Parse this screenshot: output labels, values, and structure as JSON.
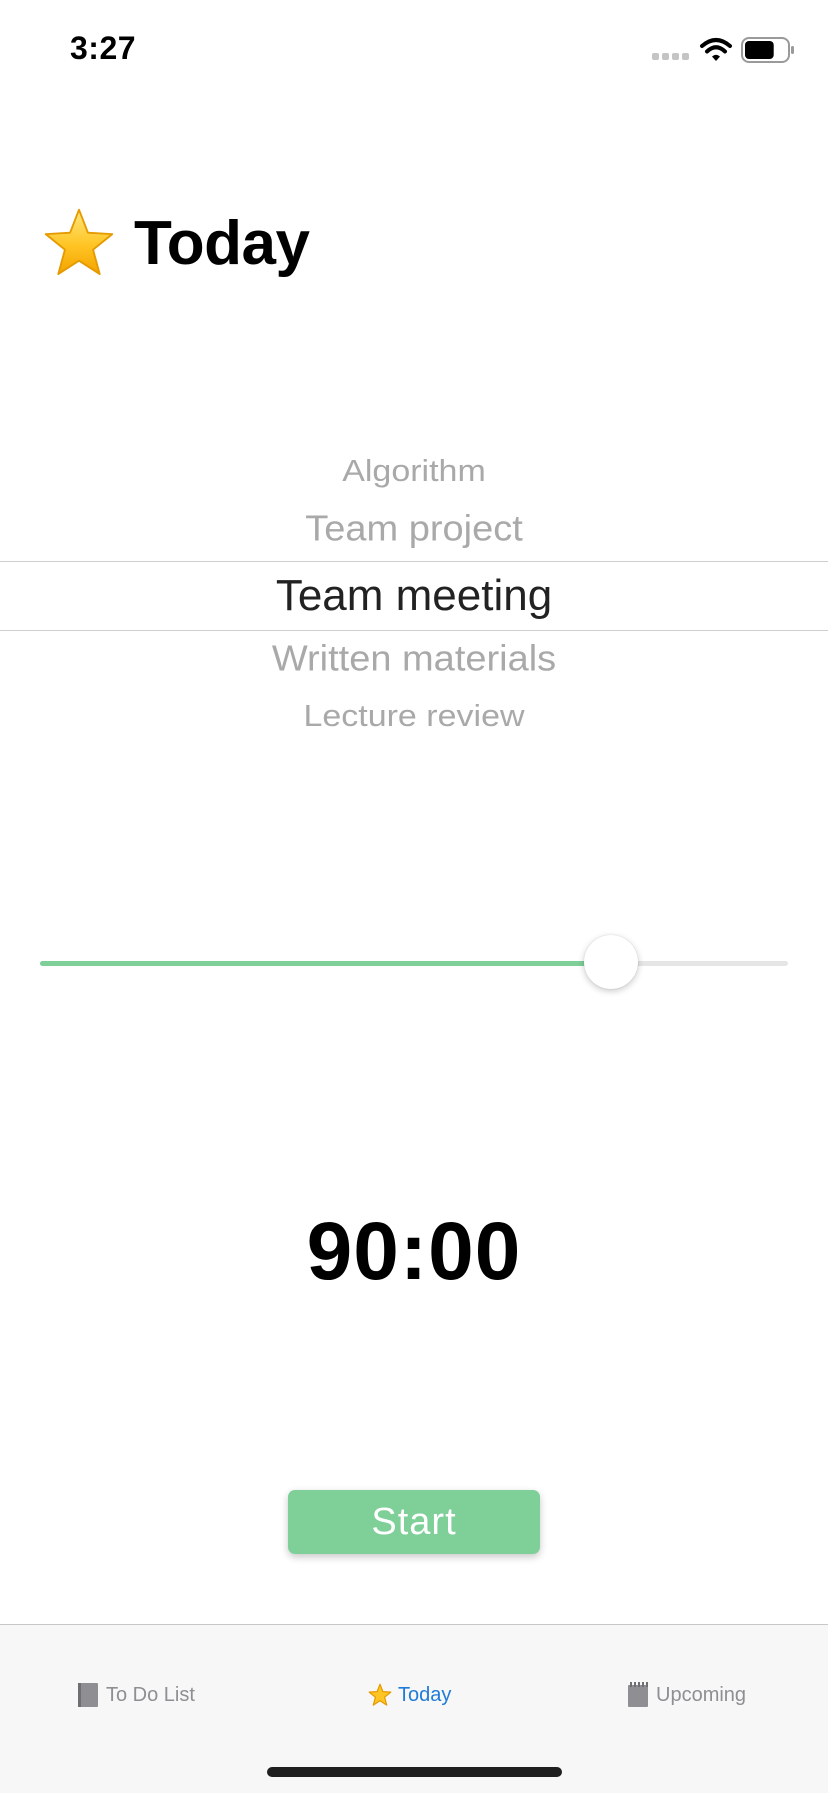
{
  "status_bar": {
    "time": "3:27",
    "icons": [
      "signal-icon",
      "wifi-icon",
      "battery-icon"
    ],
    "battery_level": 0.7
  },
  "header": {
    "icon": "star-icon",
    "title": "Today"
  },
  "picker": {
    "items": [
      "Algorithm",
      "Team project",
      "Team meeting",
      "Written materials",
      "Lecture review"
    ],
    "selected": "Team meeting"
  },
  "slider": {
    "value": 0.764,
    "fill_color": "#7ecf98",
    "track_color": "#e5e5e5"
  },
  "timer": {
    "display": "90:00"
  },
  "start_button": {
    "label": "Start",
    "color": "#7ecf98"
  },
  "tab_bar": {
    "tabs": [
      {
        "label": "To Do List",
        "icon": "notebook-icon",
        "active": false
      },
      {
        "label": "Today",
        "icon": "star-icon",
        "active": true
      },
      {
        "label": "Upcoming",
        "icon": "spiral-notepad-icon",
        "active": false
      }
    ],
    "active_color": "#1f7bd8",
    "inactive_color": "#8e8e93"
  }
}
